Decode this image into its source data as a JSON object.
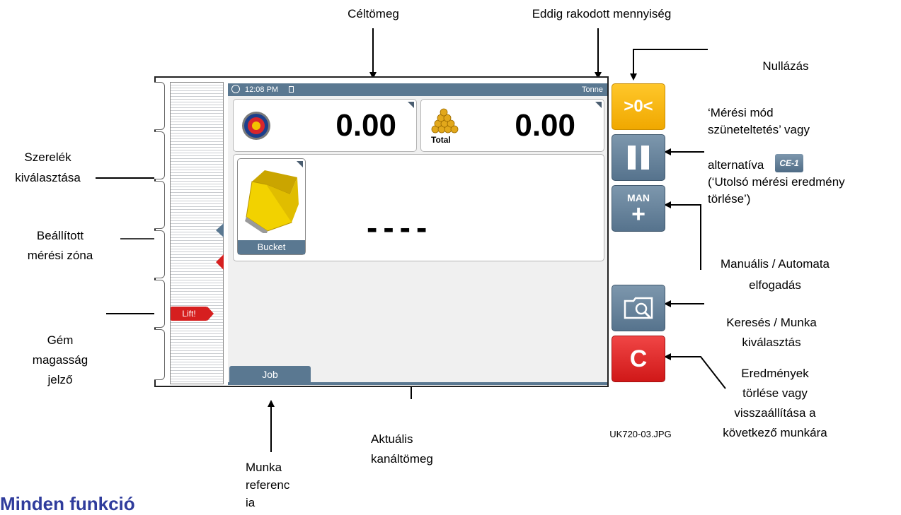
{
  "annotations": {
    "celtomeg": "Céltömeg",
    "eddig": "Eddig rakodott mennyiség",
    "nullazas": "Nullázás",
    "meresi_mod": [
      "‘Mérési mód",
      "szüneteltetés’ vagy"
    ],
    "alternativa": "alternatíva",
    "utolso": [
      "(‘Utolsó mérési eredmény",
      "törlése’)"
    ],
    "szerelek": [
      "Szerelék",
      "kiválasztása"
    ],
    "beallitott": [
      "Beállított",
      "mérési zóna"
    ],
    "manualis": [
      "Manuális / Automata",
      "elfogadás"
    ],
    "kereses": [
      "Keresés / Munka",
      "kiválasztás"
    ],
    "gem": [
      "Gém",
      "magasság",
      "jelző"
    ],
    "eredmenyek": [
      "Eredmények",
      "törlése vagy",
      "visszaállítása a",
      "következő munkára"
    ],
    "aktualis": [
      "Aktuális",
      "kanáltömeg"
    ],
    "munka": [
      "Munka",
      "referenc",
      "ia"
    ],
    "image_id": "UK720-03.JPG",
    "heading": "Minden funkció"
  },
  "screen": {
    "time": "12:08 PM",
    "unit": "Tonne",
    "target_value": "0.00",
    "total_value": "0.00",
    "total_label": "Total",
    "attachment_label": "Bucket",
    "current_weight": "----",
    "job_tab": "Job",
    "lift_label": "Lift!"
  },
  "buttons": {
    "zero": ">0<",
    "man": "MAN",
    "man_plus": "+",
    "clear": "C",
    "ce1": "CE-1"
  },
  "colors": {
    "status_bar": "#5a7891",
    "zero_button": "#f5b800",
    "clear_button": "#e02020",
    "lift_badge": "#d61f1f",
    "heading": "#2f3c9c"
  }
}
